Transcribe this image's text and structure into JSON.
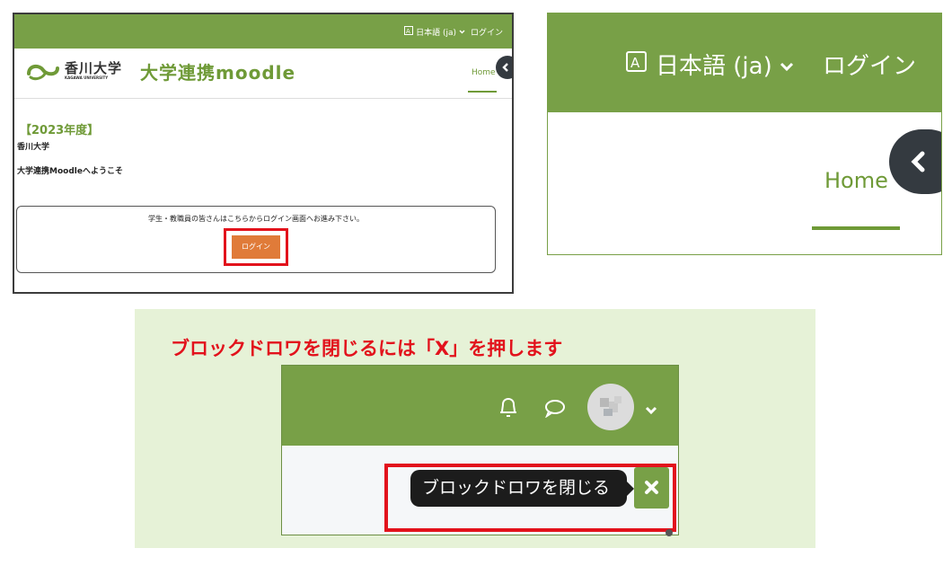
{
  "colors": {
    "primary": "#78a047",
    "accent_text": "#6f9a37",
    "highlight": "#e2121c",
    "login_button": "#e07b39",
    "drawer_button": "#343a40",
    "panel_bg": "#e6f2d7"
  },
  "panel_site": {
    "nav": {
      "language": "日本語 (ja)",
      "login": "ログイン"
    },
    "logo": {
      "university_jp": "香川大学",
      "university_en": "KAGAWA UNIVERSITY",
      "site_name": "大学連携moodle"
    },
    "nav_tab": "Home",
    "year_heading": "【2023年度】",
    "org_name": "香川大学",
    "welcome": "大学連携Moodleへようこそ",
    "login_box": {
      "instruction": "学生・教職員の皆さんはこちらからログイン画面へお進み下さい。",
      "button": "ログイン"
    }
  },
  "panel_zoom": {
    "language": "日本語 (ja)",
    "login": "ログイン",
    "nav_tab": "Home"
  },
  "panel_drawer": {
    "caption": "ブロックドロワを閉じるには「X」を押します",
    "tooltip": "ブロックドロワを閉じる",
    "icons": [
      "bell-icon",
      "message-icon",
      "avatar",
      "chevron-down-icon",
      "close-icon"
    ]
  }
}
